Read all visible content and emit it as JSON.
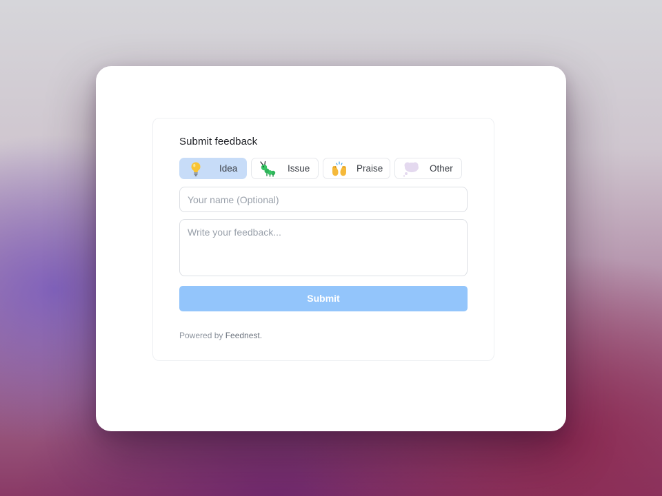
{
  "form": {
    "title": "Submit feedback",
    "types": [
      {
        "label": "Idea",
        "icon": "lightbulb-icon",
        "selected": true
      },
      {
        "label": "Issue",
        "icon": "caterpillar-icon",
        "selected": false
      },
      {
        "label": "Praise",
        "icon": "raised-hands-icon",
        "selected": false
      },
      {
        "label": "Other",
        "icon": "thought-bubble-icon",
        "selected": false
      }
    ],
    "name_placeholder": "Your name (Optional)",
    "name_value": "",
    "feedback_placeholder": "Write your feedback...",
    "feedback_value": "",
    "submit_label": "Submit"
  },
  "footer": {
    "powered_prefix": "Powered by ",
    "brand": "Feednest."
  },
  "colors": {
    "accent": "#93c5fb",
    "selected_chip": "#c7dcf8"
  }
}
